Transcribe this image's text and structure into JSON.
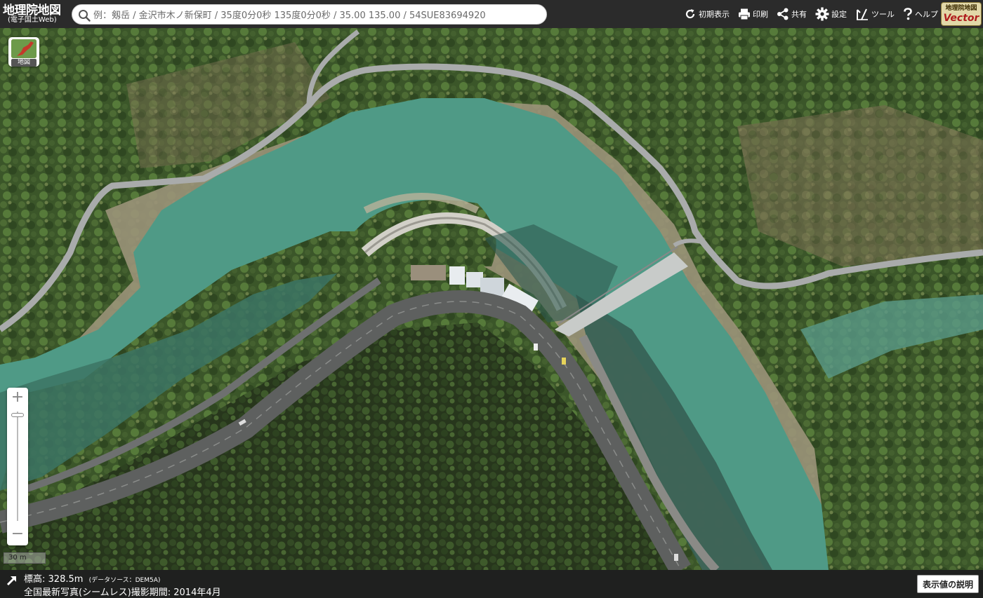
{
  "header": {
    "title": "地理院地図",
    "subtitle": "(電子国土Web)",
    "search_placeholder": "例：剱岳 / 金沢市木ノ新保町 / 35度0分0秒 135度0分0秒 / 35.00 135.00 / 54SUE83694920",
    "search_icon": "search-icon",
    "tools": [
      {
        "label": "初期表示",
        "icon": "reset-icon"
      },
      {
        "label": "印刷",
        "icon": "print-icon"
      },
      {
        "label": "共有",
        "icon": "share-icon"
      },
      {
        "label": "設定",
        "icon": "gear-icon"
      },
      {
        "label": "ツール",
        "icon": "tool-icon"
      },
      {
        "label": "ヘルプ",
        "icon": "help-icon"
      }
    ],
    "vector_badge": {
      "top": "地理院地図",
      "bottom": "Vector"
    }
  },
  "map": {
    "layer_button_label": "地図",
    "zoom_in": "+",
    "zoom_out": "−",
    "scale_label": "30 m"
  },
  "footer": {
    "elevation_label": "標高:",
    "elevation_value": "328.5m",
    "elevation_source": "(データソース：DEM5A)",
    "photo_info": "全国最新写真(シームレス)撮影期間: 2014年4月",
    "explain_button": "表示値の説明"
  },
  "colors": {
    "header_bg": "#2b2b2b",
    "water": "#4f9a86",
    "forest": "#3f5a2c",
    "road": "#6d6f6e"
  }
}
